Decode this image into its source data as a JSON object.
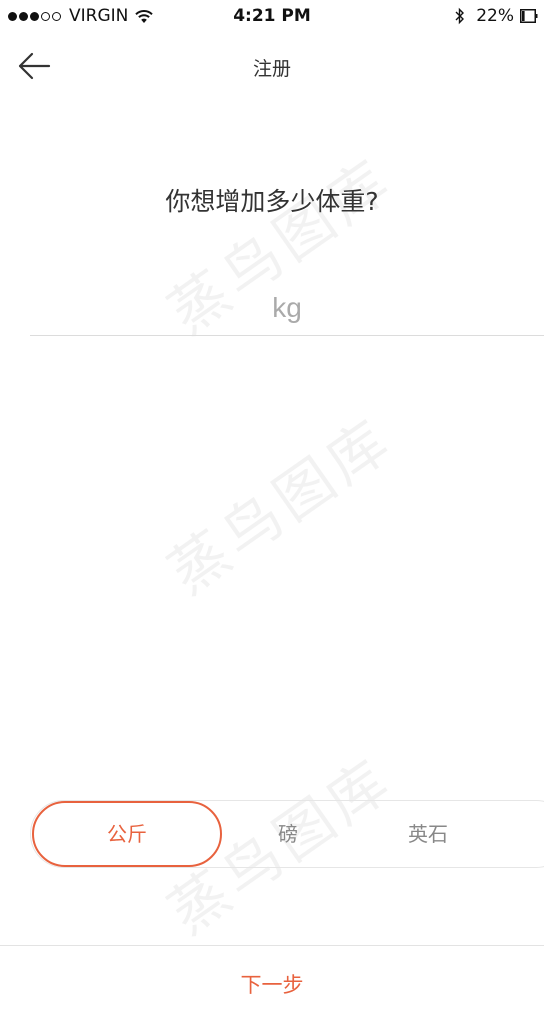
{
  "status_bar": {
    "signal_bars": 3,
    "signal_total": 5,
    "carrier": "VIRGIN",
    "time": "4:21 PM",
    "battery_percent": "22%",
    "battery_level": 0.22
  },
  "nav": {
    "title": "注册",
    "back_icon": "arrow-left-icon"
  },
  "question": "你想增加多少体重?",
  "weight_input": {
    "value": "",
    "placeholder": "kg"
  },
  "units": {
    "selected_index": 0,
    "options": [
      "公斤",
      "磅",
      "英石"
    ]
  },
  "next_button": "下一步",
  "colors": {
    "accent": "#e8623e",
    "text": "#333333",
    "placeholder": "#aaaaaa",
    "divider": "#dcdcdc"
  },
  "watermark": "蒸鸟图库"
}
